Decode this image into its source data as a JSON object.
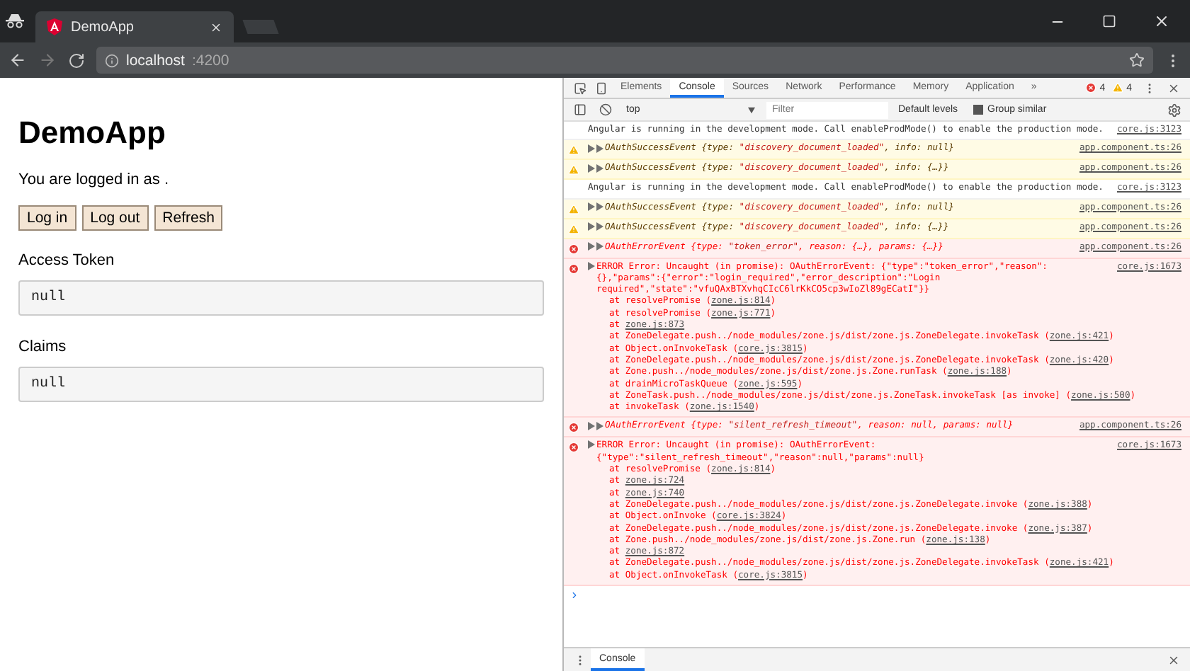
{
  "browser": {
    "tab_title": "DemoApp",
    "address_host": "localhost",
    "address_port": ":4200"
  },
  "app": {
    "title": "DemoApp",
    "login_status": "You are logged in as .",
    "buttons": [
      "Log in",
      "Log out",
      "Refresh"
    ],
    "sections": [
      {
        "label": "Access Token",
        "value": "null"
      },
      {
        "label": "Claims",
        "value": "null"
      }
    ]
  },
  "devtools": {
    "tabs": [
      {
        "label": "Elements",
        "selected": false
      },
      {
        "label": "Console",
        "selected": true
      },
      {
        "label": "Sources",
        "selected": false
      },
      {
        "label": "Network",
        "selected": false
      },
      {
        "label": "Performance",
        "selected": false
      },
      {
        "label": "Memory",
        "selected": false
      },
      {
        "label": "Application",
        "selected": false
      }
    ],
    "more": "»",
    "error_count": "4",
    "warning_count": "4",
    "context": "top",
    "filter_placeholder": "Filter",
    "levels": "Default levels",
    "group_similar": {
      "label": "Group similar",
      "checked": true
    },
    "messages": [
      {
        "kind": "info",
        "text": "Angular is running in the development mode. Call enableProdMode() to enable the production mode.",
        "source": "core.js:3123"
      },
      {
        "kind": "warning",
        "parts": [
          {
            "t": "OAuthSuccessEvent {type: ",
            "str": false
          },
          {
            "t": "\"discovery_document_loaded\"",
            "str": true
          },
          {
            "t": ", info: null}",
            "str": false
          }
        ],
        "source": "app.component.ts:26"
      },
      {
        "kind": "warning",
        "parts": [
          {
            "t": "OAuthSuccessEvent {type: ",
            "str": false
          },
          {
            "t": "\"discovery_document_loaded\"",
            "str": true
          },
          {
            "t": ", info: {…}}",
            "str": false
          }
        ],
        "source": "app.component.ts:26"
      },
      {
        "kind": "info",
        "text": "Angular is running in the development mode. Call enableProdMode() to enable the production mode.",
        "source": "core.js:3123"
      },
      {
        "kind": "warning",
        "parts": [
          {
            "t": "OAuthSuccessEvent {type: ",
            "str": false
          },
          {
            "t": "\"discovery_document_loaded\"",
            "str": true
          },
          {
            "t": ", info: null}",
            "str": false
          }
        ],
        "source": "app.component.ts:26"
      },
      {
        "kind": "warning",
        "parts": [
          {
            "t": "OAuthSuccessEvent {type: ",
            "str": false
          },
          {
            "t": "\"discovery_document_loaded\"",
            "str": true
          },
          {
            "t": ", info: {…}}",
            "str": false
          }
        ],
        "source": "app.component.ts:26"
      },
      {
        "kind": "error",
        "parts": [
          {
            "t": "OAuthErrorEvent {type: ",
            "str": false
          },
          {
            "t": "\"token_error\"",
            "str": true
          },
          {
            "t": ", reason: {…}, params: {…}}",
            "str": false
          }
        ],
        "source": "app.component.ts:26"
      },
      {
        "kind": "error",
        "text": "ERROR Error: Uncaught (in promise): OAuthErrorEvent: {\"type\":\"token_error\",\"reason\":{},\"params\":{\"error\":\"login_required\",\"error_description\":\"Login required\",\"state\":\"vfuQAxBTXvhqCIcC6lrKkCO5cp3wIoZl89gECatI\"}}",
        "source": "core.js:1673",
        "stack": [
          {
            "pre": "at resolvePromise (",
            "link": "zone.js:814",
            "post": ")"
          },
          {
            "pre": "at resolvePromise (",
            "link": "zone.js:771",
            "post": ")"
          },
          {
            "pre": "at ",
            "link": "zone.js:873"
          },
          {
            "pre": "at ZoneDelegate.push../node_modules/zone.js/dist/zone.js.ZoneDelegate.invokeTask (",
            "link": "zone.js:421",
            "post": ")"
          },
          {
            "pre": "at Object.onInvokeTask (",
            "link": "core.js:3815",
            "post": ")"
          },
          {
            "pre": "at ZoneDelegate.push../node_modules/zone.js/dist/zone.js.ZoneDelegate.invokeTask (",
            "link": "zone.js:420",
            "post": ")"
          },
          {
            "pre": "at Zone.push../node_modules/zone.js/dist/zone.js.Zone.runTask (",
            "link": "zone.js:188",
            "post": ")"
          },
          {
            "pre": "at drainMicroTaskQueue (",
            "link": "zone.js:595",
            "post": ")"
          },
          {
            "pre": "at ZoneTask.push../node_modules/zone.js/dist/zone.js.ZoneTask.invokeTask [as invoke] (",
            "link": "zone.js:500",
            "post": ")"
          },
          {
            "pre": "at invokeTask (",
            "link": "zone.js:1540",
            "post": ")"
          }
        ]
      },
      {
        "kind": "error",
        "parts": [
          {
            "t": "OAuthErrorEvent {type: ",
            "str": false
          },
          {
            "t": "\"silent_refresh_timeout\"",
            "str": true
          },
          {
            "t": ", reason: null, params: null}",
            "str": false
          }
        ],
        "source": "app.component.ts:26"
      },
      {
        "kind": "error",
        "text": "ERROR Error: Uncaught (in promise): OAuthErrorEvent: {\"type\":\"silent_refresh_timeout\",\"reason\":null,\"params\":null}",
        "source": "core.js:1673",
        "stack": [
          {
            "pre": "at resolvePromise (",
            "link": "zone.js:814",
            "post": ")"
          },
          {
            "pre": "at ",
            "link": "zone.js:724"
          },
          {
            "pre": "at ",
            "link": "zone.js:740"
          },
          {
            "pre": "at ZoneDelegate.push../node_modules/zone.js/dist/zone.js.ZoneDelegate.invoke (",
            "link": "zone.js:388",
            "post": ")"
          },
          {
            "pre": "at Object.onInvoke (",
            "link": "core.js:3824",
            "post": ")"
          },
          {
            "pre": "at ZoneDelegate.push../node_modules/zone.js/dist/zone.js.ZoneDelegate.invoke (",
            "link": "zone.js:387",
            "post": ")"
          },
          {
            "pre": "at Zone.push../node_modules/zone.js/dist/zone.js.Zone.run (",
            "link": "zone.js:138",
            "post": ")"
          },
          {
            "pre": "at ",
            "link": "zone.js:872"
          },
          {
            "pre": "at ZoneDelegate.push../node_modules/zone.js/dist/zone.js.ZoneDelegate.invokeTask (",
            "link": "zone.js:421",
            "post": ")"
          },
          {
            "pre": "at Object.onInvokeTask (",
            "link": "core.js:3815",
            "post": ")"
          }
        ]
      }
    ],
    "drawer_tabs": [
      {
        "label": "Console",
        "selected": true
      }
    ]
  }
}
